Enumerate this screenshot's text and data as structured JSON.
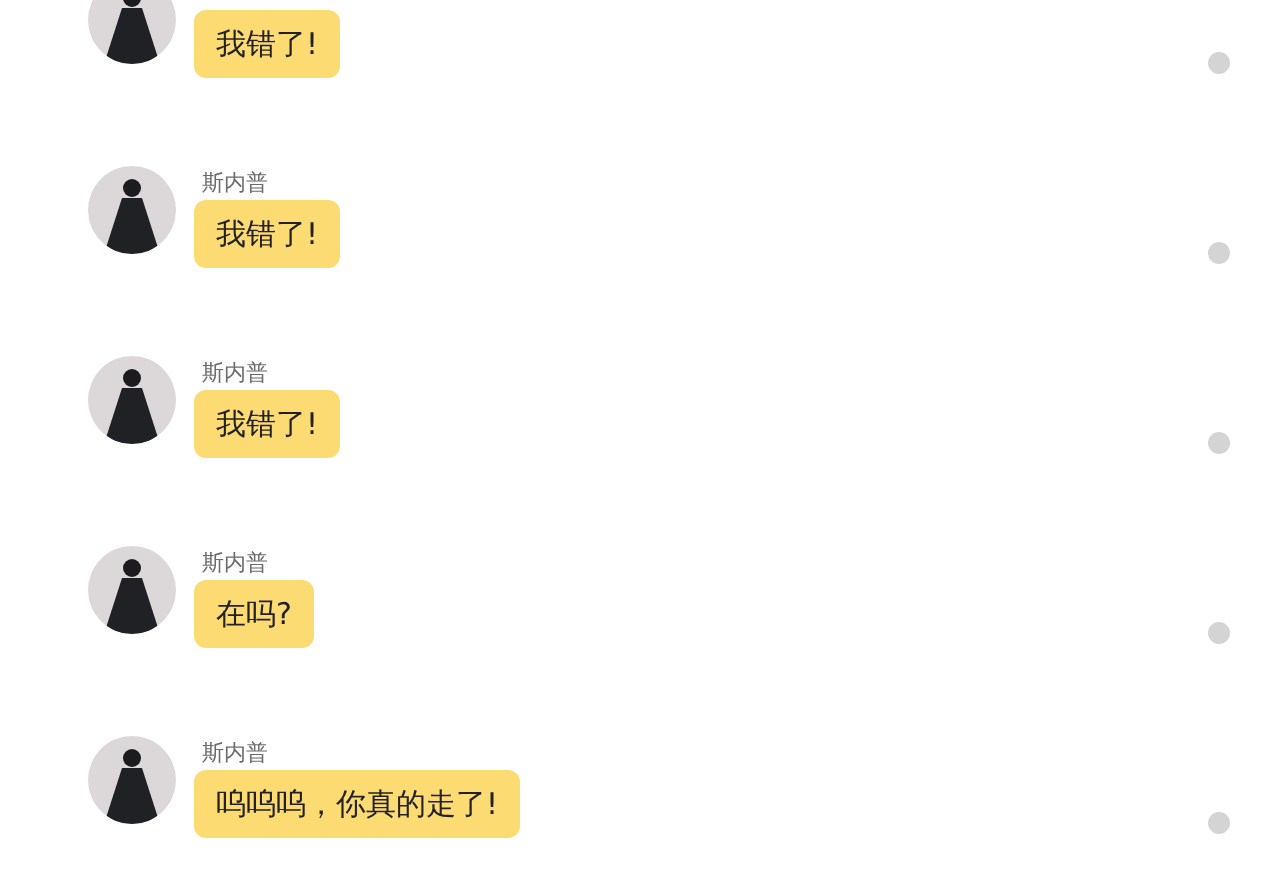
{
  "messages": [
    {
      "text": "我错了!"
    },
    {
      "name": "斯内普",
      "text": "我错了!"
    },
    {
      "name": "斯内普",
      "text": "我错了!"
    },
    {
      "name": "斯内普",
      "text": "在吗?"
    },
    {
      "name": "斯内普",
      "text": "呜呜呜，你真的走了!"
    }
  ]
}
